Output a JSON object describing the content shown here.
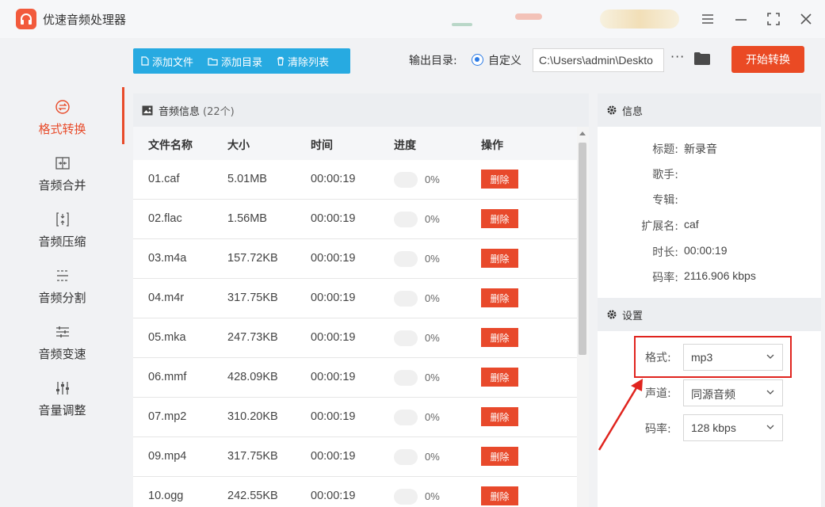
{
  "app": {
    "title": "优速音频处理器"
  },
  "sidebar": {
    "items": [
      {
        "label": "格式转换",
        "icon": "format-convert-icon"
      },
      {
        "label": "音频合并",
        "icon": "merge-icon"
      },
      {
        "label": "音频压缩",
        "icon": "compress-icon"
      },
      {
        "label": "音频分割",
        "icon": "split-icon"
      },
      {
        "label": "音频变速",
        "icon": "speed-icon"
      },
      {
        "label": "音量调整",
        "icon": "volume-icon"
      }
    ]
  },
  "toolbar": {
    "add_file": "添加文件",
    "add_dir": "添加目录",
    "clear_list": "清除列表",
    "output_label": "输出目录:",
    "output_option": "自定义",
    "output_path": "C:\\Users\\admin\\Deskto",
    "more": "···",
    "start": "开始转换"
  },
  "audio_panel": {
    "title": "音频信息",
    "count": "(22个)",
    "columns": {
      "name": "文件名称",
      "size": "大小",
      "time": "时间",
      "progress": "进度",
      "action": "操作"
    },
    "rows": [
      {
        "name": "01.caf",
        "size": "5.01MB",
        "time": "00:00:19",
        "progress": "0%",
        "action": "删除"
      },
      {
        "name": "02.flac",
        "size": "1.56MB",
        "time": "00:00:19",
        "progress": "0%",
        "action": "删除"
      },
      {
        "name": "03.m4a",
        "size": "157.72KB",
        "time": "00:00:19",
        "progress": "0%",
        "action": "删除"
      },
      {
        "name": "04.m4r",
        "size": "317.75KB",
        "time": "00:00:19",
        "progress": "0%",
        "action": "删除"
      },
      {
        "name": "05.mka",
        "size": "247.73KB",
        "time": "00:00:19",
        "progress": "0%",
        "action": "删除"
      },
      {
        "name": "06.mmf",
        "size": "428.09KB",
        "time": "00:00:19",
        "progress": "0%",
        "action": "删除"
      },
      {
        "name": "07.mp2",
        "size": "310.20KB",
        "time": "00:00:19",
        "progress": "0%",
        "action": "删除"
      },
      {
        "name": "09.mp4",
        "size": "317.75KB",
        "time": "00:00:19",
        "progress": "0%",
        "action": "删除"
      },
      {
        "name": "10.ogg",
        "size": "242.55KB",
        "time": "00:00:19",
        "progress": "0%",
        "action": "删除"
      }
    ]
  },
  "info": {
    "title": "信息",
    "fields": [
      {
        "key": "标题:",
        "value": "新录音"
      },
      {
        "key": "歌手:",
        "value": ""
      },
      {
        "key": "专辑:",
        "value": ""
      },
      {
        "key": "扩展名:",
        "value": "caf"
      },
      {
        "key": "时长:",
        "value": "00:00:19"
      },
      {
        "key": "码率:",
        "value": "2116.906 kbps"
      }
    ]
  },
  "settings": {
    "title": "设置",
    "format_label": "格式:",
    "format_value": "mp3",
    "channel_label": "声道:",
    "channel_value": "同源音频",
    "bitrate_label": "码率:",
    "bitrate_value": "128 kbps"
  },
  "colors": {
    "accent": "#e84b2a",
    "toolbar": "#27aae1",
    "highlight": "#e0241e"
  }
}
